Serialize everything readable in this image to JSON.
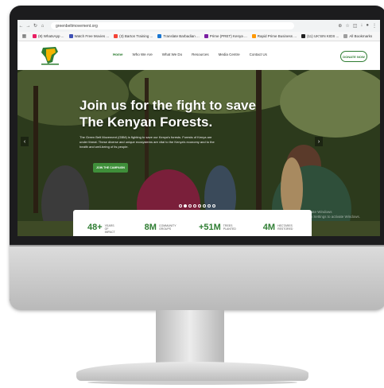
{
  "browser": {
    "url": "greenbeltmovement.org",
    "bookmarks": [
      {
        "label": "(8) WhatsApp ...",
        "color": "#e91e63"
      },
      {
        "label": "Watch Free Movies ...",
        "color": "#3f51b5"
      },
      {
        "label": "(3) Barton Training ...",
        "color": "#f44336"
      },
      {
        "label": "Translate Barbadian ...",
        "color": "#1976d2"
      },
      {
        "label": "Prime (PRET) Kenya ...",
        "color": "#7b1fa2"
      },
      {
        "label": "Rapid Prime Business ...",
        "color": "#ff9800"
      },
      {
        "label": "(11) UK'SIN KIDS ...",
        "color": "#212121"
      },
      {
        "label": "All Bookmarks",
        "color": "#9e9e9e"
      }
    ]
  },
  "site": {
    "menu": [
      "Home",
      "Who We Are",
      "What We Do",
      "Resources",
      "Media Centre",
      "Contact Us"
    ],
    "donate_label": "DONATE NOW"
  },
  "hero": {
    "title_line1": "Join us for the fight to save",
    "title_line2": "The Kenyan Forests.",
    "body": "The Green Belt Movement (GBM) is fighting to save our Kenya's forests. Forests of Kenya are under threat. These diverse and unique ecosystems are vital to the Kenya's economy and to the health and well-being of its people.",
    "button_label": "JOIN THE CAMPAIGN",
    "watermark_line1": "Activate Windows",
    "watermark_line2": "Go to Settings to activate Windows."
  },
  "stats": [
    {
      "value": "48+",
      "label": "YEARS OF IMPACT"
    },
    {
      "value": "8M",
      "label": "COMMUNITY GROUPS"
    },
    {
      "value": "+51M",
      "label": "TREES PLANTED"
    },
    {
      "value": "4M",
      "label": "HECTARES RESTORED"
    }
  ],
  "colors": {
    "brand": "#2e7d32"
  }
}
